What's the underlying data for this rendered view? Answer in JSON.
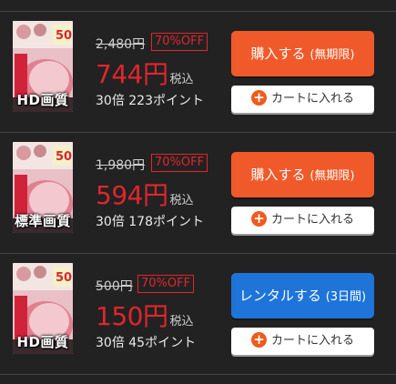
{
  "colors": {
    "background": "#222222",
    "price_red": "#e0262d",
    "buy_orange": "#f05a2a",
    "rental_blue": "#1e74d9",
    "cart_plus_orange": "#f05a1e"
  },
  "offers": [
    {
      "thumbnail_icon": "video-cover-thumbnail",
      "quality": "HD画質",
      "original_price": "2,480円",
      "discount": "70%OFF",
      "price": "744円",
      "tax_note": "税込",
      "points": "30倍 223ポイント",
      "primary_label": "購入する",
      "primary_sub": "(無期限)",
      "primary_color": "#f05a2a",
      "cart_icon": "plus-circle-icon",
      "cart_label": "カートに入れる"
    },
    {
      "thumbnail_icon": "video-cover-thumbnail",
      "quality": "標準画質",
      "original_price": "1,980円",
      "discount": "70%OFF",
      "price": "594円",
      "tax_note": "税込",
      "points": "30倍 178ポイント",
      "primary_label": "購入する",
      "primary_sub": "(無期限)",
      "primary_color": "#f05a2a",
      "cart_icon": "plus-circle-icon",
      "cart_label": "カートに入れる"
    },
    {
      "thumbnail_icon": "video-cover-thumbnail",
      "quality": "HD画質",
      "original_price": "500円",
      "discount": "70%OFF",
      "price": "150円",
      "tax_note": "税込",
      "points": "30倍 45ポイント",
      "primary_label": "レンタルする",
      "primary_sub": "(3日間)",
      "primary_color": "#1e74d9",
      "cart_icon": "plus-circle-icon",
      "cart_label": "カートに入れる"
    }
  ]
}
